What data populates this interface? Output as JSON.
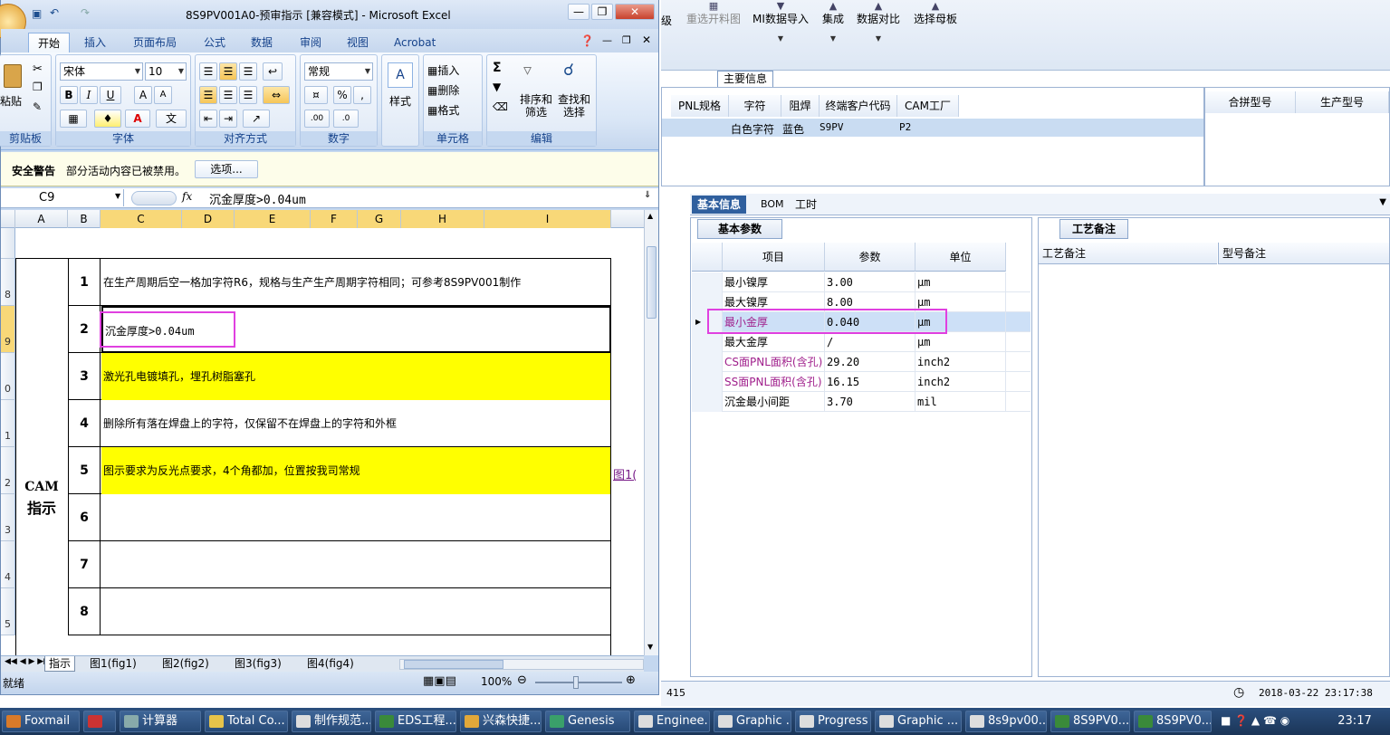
{
  "excel": {
    "title": "8S9PV001A0-预审指示  [兼容模式] - Microsoft Excel",
    "tabs": [
      "开始",
      "插入",
      "页面布局",
      "公式",
      "数据",
      "审阅",
      "视图",
      "Acrobat"
    ],
    "ribbon": {
      "paste": "粘贴",
      "clipboard_group": "剪贴板",
      "font_name": "宋体",
      "font_size": "10",
      "font_group": "字体",
      "align_group": "对齐方式",
      "number_format": "常规",
      "number_group": "数字",
      "style_btn": "样式",
      "insert_btn": "插入",
      "delete_btn": "删除",
      "format_btn": "格式",
      "cells_group": "单元格",
      "sort_filter": "排序和\n筛选",
      "find_select": "查找和\n选择",
      "edit_group": "编辑",
      "percent": "%",
      "comma": ","
    },
    "security": {
      "title": "安全警告",
      "message": "部分活动内容已被禁用。",
      "options_btn": "选项..."
    },
    "formula_bar": {
      "name_box": "C9",
      "fx": "fx",
      "content": "沉金厚度>0.04um"
    },
    "columns": [
      "A",
      "B",
      "C",
      "D",
      "E",
      "F",
      "G",
      "H",
      "I"
    ],
    "row_headers": [
      "8",
      "9",
      "0",
      "1",
      "2",
      "3",
      "4",
      "5"
    ],
    "section_label_1": "CAM",
    "section_label_2": "指示",
    "rows": [
      {
        "num": "1",
        "text": "在生产周期后空一格加字符R6，规格与生产生产周期字符相同；可参考8S9PV001制作",
        "yellow": false
      },
      {
        "num": "2",
        "text": "沉金厚度>0.04um",
        "yellow": false
      },
      {
        "num": "3",
        "text": "激光孔电镀填孔，埋孔树脂塞孔",
        "yellow": true
      },
      {
        "num": "4",
        "text": "删除所有落在焊盘上的字符，仅保留不在焊盘上的字符和外框",
        "yellow": false
      },
      {
        "num": "5",
        "text": "图示要求为反光点要求，4个角都加，位置按我司常规",
        "yellow": true
      },
      {
        "num": "6",
        "text": "",
        "yellow": false
      },
      {
        "num": "7",
        "text": "",
        "yellow": false
      },
      {
        "num": "8",
        "text": "",
        "yellow": false
      }
    ],
    "link_text": "图1(",
    "sheet_tabs": [
      "指示",
      "图1(fig1)",
      "图2(fig2)",
      "图3(fig3)",
      "图4(fig4)"
    ],
    "status_ready": "就绪",
    "zoom": "100%"
  },
  "app": {
    "toolbar": [
      "重选开料图",
      "MI数据导入",
      "集成",
      "数据对比",
      "选择母板"
    ],
    "toolbar_left_fragment": "级",
    "main_info_tab": "主要信息",
    "grid_headers": [
      "PNL规格",
      "字符",
      "阻焊",
      "终端客户代码",
      "CAM工厂"
    ],
    "grid_row": {
      "char": "白色字符",
      "mask": "蓝色",
      "customer": "S9PV",
      "factory": "P2"
    },
    "merge_headers": [
      "合拼型号",
      "生产型号"
    ],
    "bottom_tabs": [
      "基本信息",
      "BOM",
      "工时"
    ],
    "param_tab": "基本参数",
    "param_headers": [
      "项目",
      "参数",
      "单位"
    ],
    "params": [
      {
        "item": "最小镍厚",
        "value": "3.00",
        "unit": "μm",
        "color": "#000000"
      },
      {
        "item": "最大镍厚",
        "value": "8.00",
        "unit": "μm",
        "color": "#000000"
      },
      {
        "item": "最小金厚",
        "value": "0.040",
        "unit": "μm",
        "color": "#a0208c"
      },
      {
        "item": "最大金厚",
        "value": "/",
        "unit": "μm",
        "color": "#000000"
      },
      {
        "item": "CS面PNL面积(含孔)",
        "value": "29.20",
        "unit": "inch2",
        "color": "#a0208c"
      },
      {
        "item": "SS面PNL面积(含孔)",
        "value": "16.15",
        "unit": "inch2",
        "color": "#a0208c"
      },
      {
        "item": "沉金最小间距",
        "value": "3.70",
        "unit": "mil",
        "color": "#000000"
      }
    ],
    "craft_tab": "工艺备注",
    "craft_headers": [
      "工艺备注",
      "型号备注"
    ],
    "status_left": "415",
    "status_time": "2018-03-22 23:17:38"
  },
  "taskbar": {
    "items": [
      "Foxmail",
      "",
      "计算器",
      "Total Co...",
      "制作规范...",
      "EDS工程...",
      "兴森快捷...",
      "Genesis",
      "Enginee...",
      "Graphic ...",
      "Progress",
      "Graphic ...",
      "8s9pv00...",
      "8S9PV0...",
      "8S9PV0..."
    ],
    "clock": "23:17"
  },
  "colors": {
    "highlight": "#e040e0",
    "yellow": "#ffff00",
    "accent": "#2f5f9e"
  }
}
